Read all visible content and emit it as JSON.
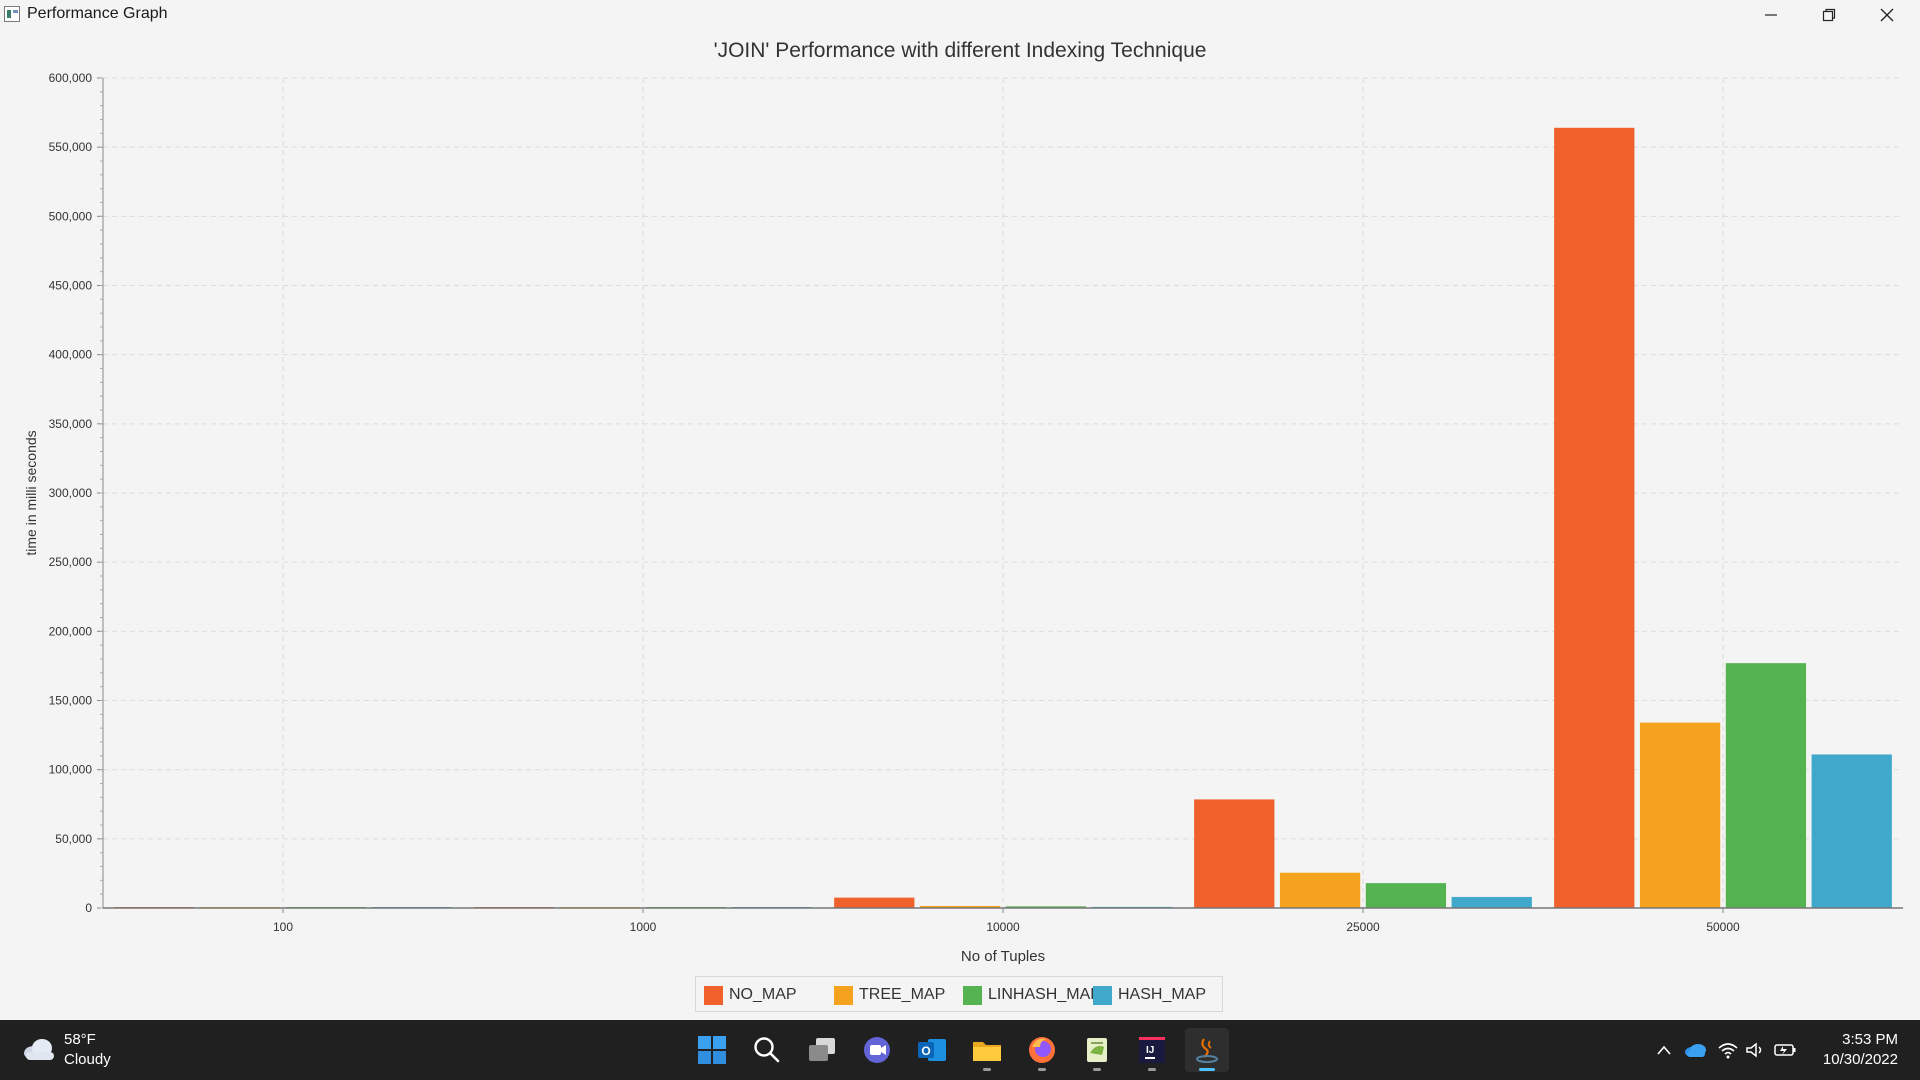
{
  "window": {
    "title": "Performance Graph"
  },
  "chart_data": {
    "type": "bar",
    "title": "'JOIN' Performance with different Indexing Technique",
    "xlabel": "No of Tuples",
    "ylabel": "time in milli seconds",
    "categories": [
      "100",
      "1000",
      "10000",
      "25000",
      "50000"
    ],
    "ylim": [
      0,
      600000
    ],
    "yticks": [
      "0",
      "50,000",
      "100,000",
      "150,000",
      "200,000",
      "250,000",
      "300,000",
      "350,000",
      "400,000",
      "450,000",
      "500,000",
      "550,000",
      "600,000"
    ],
    "grid": true,
    "legend_position": "bottom-center",
    "series": [
      {
        "name": "NO_MAP",
        "color": "#f0612b",
        "values": [
          50,
          500,
          7500,
          78500,
          564000
        ]
      },
      {
        "name": "TREE_MAP",
        "color": "#f5a31e",
        "values": [
          10,
          100,
          1500,
          25500,
          134000
        ]
      },
      {
        "name": "LINHASH_MAP",
        "color": "#56b351",
        "values": [
          10,
          100,
          1200,
          18000,
          177000
        ]
      },
      {
        "name": "HASH_MAP",
        "color": "#40a8cb",
        "values": [
          10,
          100,
          800,
          8000,
          111000
        ]
      }
    ]
  },
  "taskbar": {
    "weather": {
      "temp": "58°F",
      "condition": "Cloudy"
    },
    "clock": {
      "time": "3:53 PM",
      "date": "10/30/2022"
    },
    "apps": [
      {
        "name": "start",
        "icon": "windows-start-icon"
      },
      {
        "name": "search",
        "icon": "search-icon"
      },
      {
        "name": "task-view",
        "icon": "task-view-icon"
      },
      {
        "name": "teams",
        "icon": "teams-chat-icon"
      },
      {
        "name": "outlook",
        "icon": "outlook-icon"
      },
      {
        "name": "file-explorer",
        "icon": "folder-icon"
      },
      {
        "name": "firefox",
        "icon": "firefox-icon"
      },
      {
        "name": "notepad-plus",
        "icon": "notepad-icon"
      },
      {
        "name": "intellij",
        "icon": "intellij-icon"
      },
      {
        "name": "java-app",
        "icon": "java-app-icon"
      }
    ],
    "tray": [
      "chevron-up-icon",
      "onedrive-icon",
      "wifi-icon",
      "volume-icon",
      "battery-icon"
    ]
  }
}
